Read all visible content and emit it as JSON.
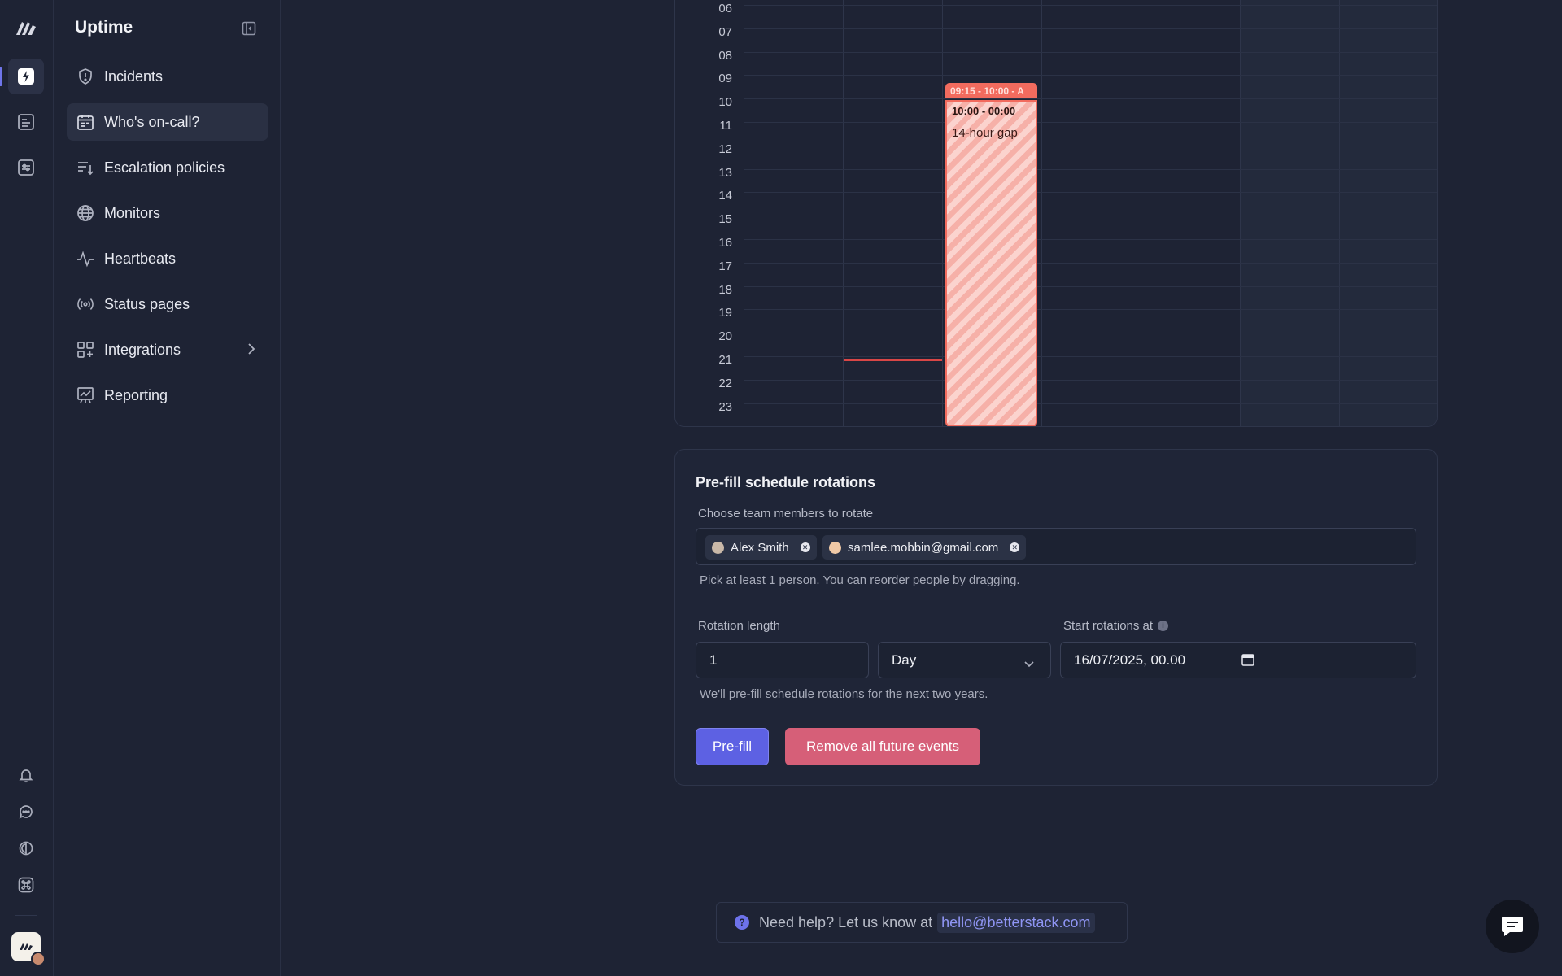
{
  "app": {
    "title": "Uptime"
  },
  "sidebar": {
    "items": [
      {
        "label": "Incidents",
        "icon": "shield-icon"
      },
      {
        "label": "Who's on-call?",
        "icon": "calendar-icon",
        "active": true
      },
      {
        "label": "Escalation policies",
        "icon": "escalation-icon"
      },
      {
        "label": "Monitors",
        "icon": "globe-icon"
      },
      {
        "label": "Heartbeats",
        "icon": "pulse-icon"
      },
      {
        "label": "Status pages",
        "icon": "broadcast-icon"
      },
      {
        "label": "Integrations",
        "icon": "integrations-icon",
        "has_submenu": true
      },
      {
        "label": "Reporting",
        "icon": "chart-icon"
      }
    ]
  },
  "calendar": {
    "hours": [
      "06",
      "07",
      "08",
      "09",
      "10",
      "11",
      "12",
      "13",
      "14",
      "15",
      "16",
      "17",
      "18",
      "19",
      "20",
      "21",
      "22",
      "23"
    ],
    "event_top": "09:15 - 10:00 - A",
    "gap": {
      "time": "10:00 - 00:00",
      "label": "14-hour gap"
    }
  },
  "prefill": {
    "title": "Pre-fill schedule rotations",
    "members_label": "Choose team members to rotate",
    "members": [
      "Alex Smith",
      "samlee.mobbin@gmail.com"
    ],
    "members_hint": "Pick at least 1 person. You can reorder people by dragging.",
    "rotation_label": "Rotation length",
    "rotation_value": "1",
    "rotation_unit": "Day",
    "start_label": "Start rotations at",
    "start_value": "16/07/2025, 00.00",
    "rotation_hint": "We'll pre-fill schedule rotations for the next two years.",
    "prefill_button": "Pre-fill",
    "remove_button": "Remove all future events"
  },
  "help": {
    "text": "Need help? Let us know at",
    "email": "hello@betterstack.com"
  },
  "colors": {
    "accent": "#5d61e3",
    "danger": "#d65f78",
    "event": "#f26b5e"
  }
}
